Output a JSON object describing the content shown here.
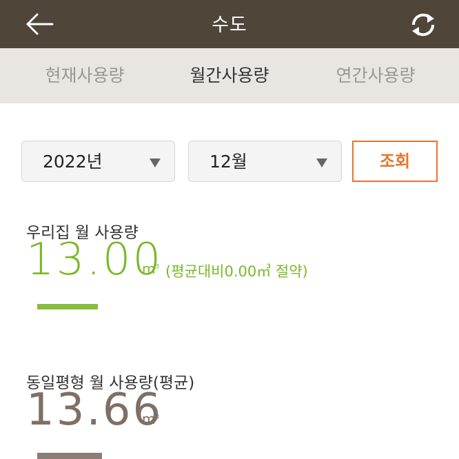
{
  "header": {
    "title": "수도",
    "back_icon": "arrow-left-icon",
    "refresh_icon": "refresh-icon"
  },
  "tabs": [
    {
      "label": "현재사용량",
      "active": false
    },
    {
      "label": "월간사용량",
      "active": true
    },
    {
      "label": "연간사용량",
      "active": false
    }
  ],
  "filters": {
    "year": "2022년",
    "month": "12월",
    "query_label": "조회"
  },
  "my_usage": {
    "label": "우리집 월 사용량",
    "value": "13.00",
    "unit": "m",
    "unit_sup": "3",
    "comparison": "(평균대비0.00㎥ 절약)"
  },
  "avg_usage": {
    "label": "동일평형 월 사용량(평균)",
    "value": "13.66",
    "unit": "m",
    "unit_sup": "3"
  },
  "colors": {
    "header_bg": "#4f4639",
    "accent_green": "#7ab829",
    "accent_orange": "#e8742a",
    "avg_brown": "#7e7066"
  }
}
